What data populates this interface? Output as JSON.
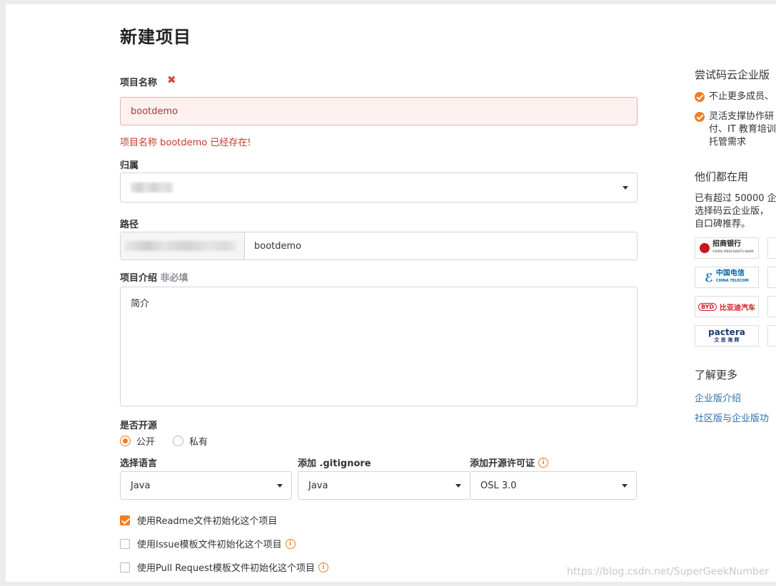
{
  "page_title": "新建项目",
  "name_field": {
    "label": "项目名称",
    "value": "bootdemo",
    "error": "项目名称 bootdemo 已经存在!"
  },
  "owner_field": {
    "label": "归属"
  },
  "path_field": {
    "label": "路径",
    "value": "bootdemo"
  },
  "desc_field": {
    "label": "项目介绍",
    "optional": "非必填",
    "value": "简介"
  },
  "visibility": {
    "label": "是否开源",
    "options": [
      "公开",
      "私有"
    ],
    "selected": "公开"
  },
  "language": {
    "label": "选择语言",
    "value": "Java"
  },
  "gitignore": {
    "label": "添加 .gitignore",
    "value": "Java"
  },
  "license": {
    "label": "添加开源许可证",
    "value": "OSL 3.0"
  },
  "init_options": [
    {
      "label": "使用Readme文件初始化这个项目",
      "checked": true
    },
    {
      "label": "使用Issue模板文件初始化这个项目",
      "checked": false
    },
    {
      "label": "使用Pull Request模板文件初始化这个项目",
      "checked": false
    }
  ],
  "sidebar": {
    "heading": "尝试码云企业版",
    "features": [
      "不止更多成员、",
      "灵活支撑协作研",
      "付、IT 教育培训",
      "托管需求"
    ],
    "users_heading": "他们都在用",
    "users_text": [
      "已有超过 50000 企",
      "选择码云企业版，",
      "自口碑推荐。"
    ],
    "logos": [
      {
        "name": "招商银行",
        "sub": "CHINA MERCHANTS BANK",
        "color": "#c8161d"
      },
      {
        "name": "中国电信",
        "sub": "CHINA TELECOM",
        "color": "#0066b3"
      },
      {
        "name": "比亚迪汽车",
        "sub": "BYD",
        "color": "#d71920"
      },
      {
        "name": "pactera",
        "sub": "文 思 海 辉",
        "color": "#1b3a6b"
      }
    ],
    "learn_heading": "了解更多",
    "links": [
      "企业版介绍",
      "社区版与企业版功"
    ]
  },
  "watermark": "https://blog.csdn.net/SuperGeekNumber",
  "colors": {
    "accent": "#f57c22",
    "error": "#c0392b",
    "link": "#2d6ea5"
  }
}
